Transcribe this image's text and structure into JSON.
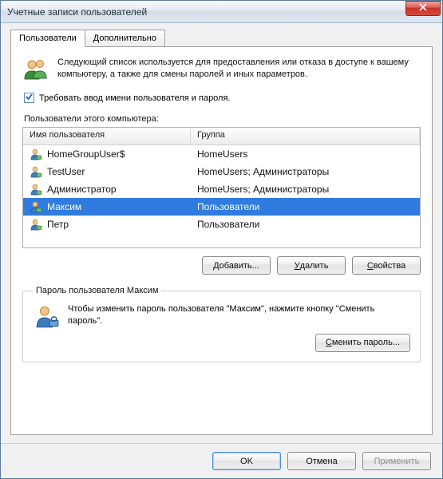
{
  "window": {
    "title": "Учетные записи пользователей"
  },
  "tabs": {
    "users": "Пользователи",
    "advanced": "Дополнительно"
  },
  "intro": "Следующий список используется для предоставления или отказа в доступе к вашему компьютеру, а также для смены паролей и иных параметров.",
  "require_login": {
    "before": "Т",
    "after": "ребовать ввод имени пользователя и пароля."
  },
  "list_label": "Пользователи этого компьютера:",
  "columns": {
    "name": "Имя пользователя",
    "group": "Группа"
  },
  "users": [
    {
      "name": "HomeGroupUser$",
      "group": "HomeUsers",
      "selected": false
    },
    {
      "name": "TestUser",
      "group": "HomeUsers; Администраторы",
      "selected": false
    },
    {
      "name": "Администратор",
      "group": "HomeUsers; Администраторы",
      "selected": false
    },
    {
      "name": "Максим",
      "group": "Пользователи",
      "selected": true
    },
    {
      "name": "Петр",
      "group": "Пользователи",
      "selected": false
    }
  ],
  "buttons": {
    "add_pre": "Д",
    "add_post": "обавить...",
    "remove_pre": "У",
    "remove_post": "далить",
    "props_pre": "С",
    "props_post": "войства",
    "change_pw_pre": "С",
    "change_pw_post": "менить пароль...",
    "ok": "OK",
    "cancel": "Отмена",
    "apply": "Применить"
  },
  "password_group": {
    "legend": "Пароль пользователя Максим",
    "text": "Чтобы изменить пароль пользователя \"Максим\", нажмите кнопку \"Сменить пароль\"."
  }
}
